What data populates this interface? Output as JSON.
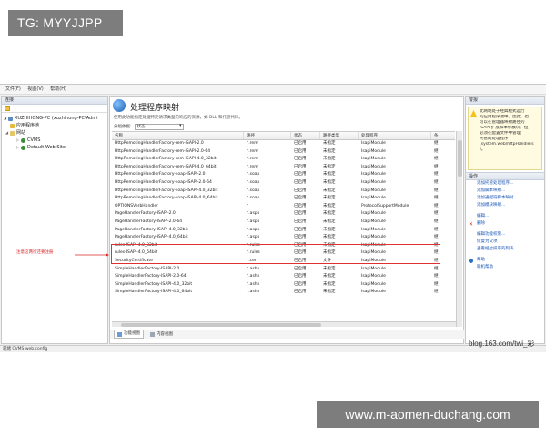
{
  "banners": {
    "top_left": "TG: MYYJJPP",
    "bottom_right": "www.m-aomen-duchang.com"
  },
  "watermark": "blog.163.com/twi_彩",
  "menu": [
    "文件(F)",
    "视图(V)",
    "帮助(H)"
  ],
  "left_pane": {
    "title": "连接",
    "tree": [
      {
        "label": "XUZHIHONG-PC (xuzhihong-PC\\Admi",
        "icon": "server-icon",
        "level": 0
      },
      {
        "label": "应用程序池",
        "icon": "app-pool-icon",
        "level": 1
      },
      {
        "label": "网站",
        "icon": "sites-folder-icon",
        "level": 1
      },
      {
        "label": "CVMS",
        "icon": "site-icon",
        "level": 2
      },
      {
        "label": "Default Web Site",
        "icon": "site-icon",
        "level": 2
      }
    ]
  },
  "main": {
    "title": "处理程序映射",
    "description": "使用此功能指定处理特定请求类型的响应的资源，如 DLL 和托管代码。",
    "group_label": "分组依据:",
    "group_value": "状态",
    "columns": [
      "名称",
      "路径",
      "状态",
      "路径类型",
      "处理程序",
      "条"
    ],
    "rows": [
      [
        "HttpRemotingHandlerFactory-rem-ISAPI-2.0",
        "*.rem",
        "已启用",
        "未指定",
        "IsapiModule",
        "继"
      ],
      [
        "HttpRemotingHandlerFactory-rem-ISAPI-2.0-64",
        "*.rem",
        "已启用",
        "未指定",
        "IsapiModule",
        "继"
      ],
      [
        "HttpRemotingHandlerFactory-rem-ISAPI-4.0_32bit",
        "*.rem",
        "已启用",
        "未指定",
        "IsapiModule",
        "继"
      ],
      [
        "HttpRemotingHandlerFactory-rem-ISAPI-4.0_64bit",
        "*.rem",
        "已启用",
        "未指定",
        "IsapiModule",
        "继"
      ],
      [
        "HttpRemotingHandlerFactory-soap-ISAPI-2.0",
        "*.soap",
        "已启用",
        "未指定",
        "IsapiModule",
        "继"
      ],
      [
        "HttpRemotingHandlerFactory-soap-ISAPI-2.0-64",
        "*.soap",
        "已启用",
        "未指定",
        "IsapiModule",
        "继"
      ],
      [
        "HttpRemotingHandlerFactory-soap-ISAPI-4.0_32bit",
        "*.soap",
        "已启用",
        "未指定",
        "IsapiModule",
        "继"
      ],
      [
        "HttpRemotingHandlerFactory-soap-ISAPI-4.0_64bit",
        "*.soap",
        "已启用",
        "未指定",
        "IsapiModule",
        "继"
      ],
      [
        "OPTIONSVerbHandler",
        "*",
        "已启用",
        "未指定",
        "ProtocolSupportModule",
        "继"
      ],
      [
        "PageHandlerFactory-ISAPI-2.0",
        "*.aspx",
        "已启用",
        "未指定",
        "IsapiModule",
        "继"
      ],
      [
        "PageHandlerFactory-ISAPI-2.0-64",
        "*.aspx",
        "已启用",
        "未指定",
        "IsapiModule",
        "继"
      ],
      [
        "PageHandlerFactory-ISAPI-4.0_32bit",
        "*.aspx",
        "已启用",
        "未指定",
        "IsapiModule",
        "继"
      ],
      [
        "PageHandlerFactory-ISAPI-4.0_64bit",
        "*.aspx",
        "已启用",
        "未指定",
        "IsapiModule",
        "继"
      ],
      [
        "rules-ISAPI-4.0_32bit",
        "*.rules",
        "已启用",
        "未指定",
        "IsapiModule",
        "继"
      ],
      [
        "rules-ISAPI-4.0_64bit",
        "*.rules",
        "已启用",
        "未指定",
        "IsapiModule",
        "继"
      ],
      [
        "SecurityCertificate",
        "*.cer",
        "已启用",
        "文件",
        "IsapiModule",
        "继"
      ],
      [
        "SimpleHandlerFactory-ISAPI-2.0",
        "*.ashx",
        "已启用",
        "未指定",
        "IsapiModule",
        "继"
      ],
      [
        "SimpleHandlerFactory-ISAPI-2.0-64",
        "*.ashx",
        "已启用",
        "未指定",
        "IsapiModule",
        "继"
      ],
      [
        "SimpleHandlerFactory-ISAPI-4.0_32bit",
        "*.ashx",
        "已启用",
        "未指定",
        "IsapiModule",
        "继"
      ],
      [
        "SimpleHandlerFactory-ISAPI-4.0_64bit",
        "*.ashx",
        "已启用",
        "未指定",
        "IsapiModule",
        "继"
      ]
    ],
    "tabs": [
      "功能视图",
      "内容视图"
    ]
  },
  "annotation": "注意这两行还要注册",
  "right_pane": {
    "title": "警报",
    "alert_lines": [
      "此网站处于经典模式运行",
      "的应用程序池中。因此，也",
      "可以在管理器映射路径的",
      "ISAPI 扩展和本机模块。但",
      "必须在配置文件中管理",
      "托管的处理程序",
      "(system.web/httpHandlers",
      ")。"
    ],
    "actions_title": "操作",
    "actions": [
      "添加托管处理程序...",
      "添加脚本映射...",
      "添加通配符脚本映射...",
      "添加模块映射...",
      "编辑...",
      "删除",
      "编辑功能权限...",
      "恢复为父项",
      "查看经过排序的列表...",
      "帮助",
      "联机帮助"
    ]
  },
  "status": "就绪  CVMS  web.config"
}
